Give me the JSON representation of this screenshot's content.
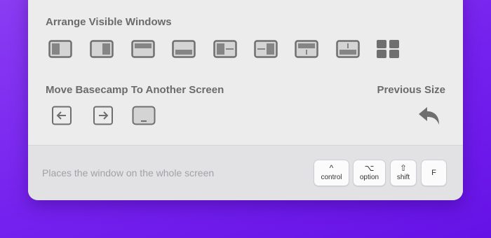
{
  "arrange": {
    "title": "Arrange Visible Windows",
    "layouts": [
      {
        "name": "left-half-icon"
      },
      {
        "name": "right-half-icon"
      },
      {
        "name": "top-half-icon"
      },
      {
        "name": "bottom-half-icon"
      },
      {
        "name": "top-left-quarter-icon"
      },
      {
        "name": "top-right-quarter-icon"
      },
      {
        "name": "bottom-left-quarter-icon"
      },
      {
        "name": "bottom-right-quarter-icon"
      },
      {
        "name": "four-grid-icon"
      }
    ]
  },
  "move": {
    "title": "Move Basecamp To Another Screen",
    "buttons": [
      {
        "name": "move-left-screen-icon"
      },
      {
        "name": "move-right-screen-icon"
      },
      {
        "name": "fullscreen-icon"
      }
    ]
  },
  "previous": {
    "title": "Previous Size",
    "icon": "undo-arrow-icon"
  },
  "footer": {
    "hint": "Places the window on the whole screen",
    "keys": [
      {
        "symbol": "^",
        "label": "control"
      },
      {
        "symbol": "⌥",
        "label": "option"
      },
      {
        "symbol": "⇧",
        "label": "shift"
      },
      {
        "symbol": "",
        "label": "F"
      }
    ]
  },
  "colors": {
    "background": "#7420ee",
    "panel": "#ececed",
    "footer": "#e2e2e4",
    "icon_stroke": "#6f6f6f",
    "icon_fill": "#858585",
    "icon_light": "#d4d4d4"
  }
}
